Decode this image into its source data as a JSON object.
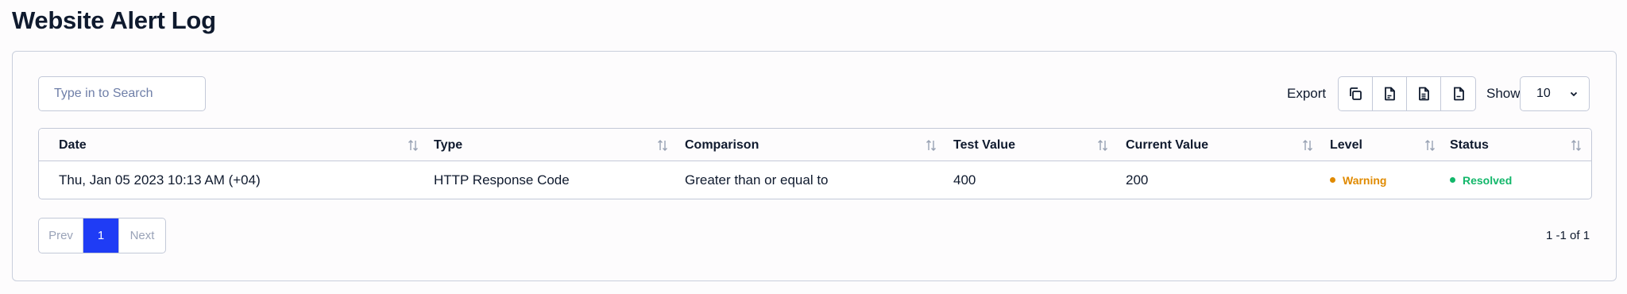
{
  "page": {
    "title": "Website Alert Log"
  },
  "toolbar": {
    "search_placeholder": "Type in to Search",
    "export_label": "Export",
    "export_buttons": [
      "copy-icon",
      "csv-file-icon",
      "excel-file-icon",
      "pdf-file-icon"
    ],
    "show_label": "Show",
    "show_value": "10"
  },
  "table": {
    "columns": [
      "Date",
      "Type",
      "Comparison",
      "Test Value",
      "Current Value",
      "Level",
      "Status"
    ],
    "rows": [
      {
        "date": "Thu, Jan 05 2023 10:13 AM (+04)",
        "type": "HTTP Response Code",
        "comparison": "Greater than or equal to",
        "test_value": "400",
        "current_value": "200",
        "level": "Warning",
        "status": "Resolved"
      }
    ]
  },
  "colors": {
    "warning": "#e08a00",
    "resolved": "#12b76a",
    "accent": "#1f3cf5"
  },
  "pagination": {
    "prev": "Prev",
    "current": "1",
    "next": "Next",
    "range": "1 -1 of 1"
  }
}
